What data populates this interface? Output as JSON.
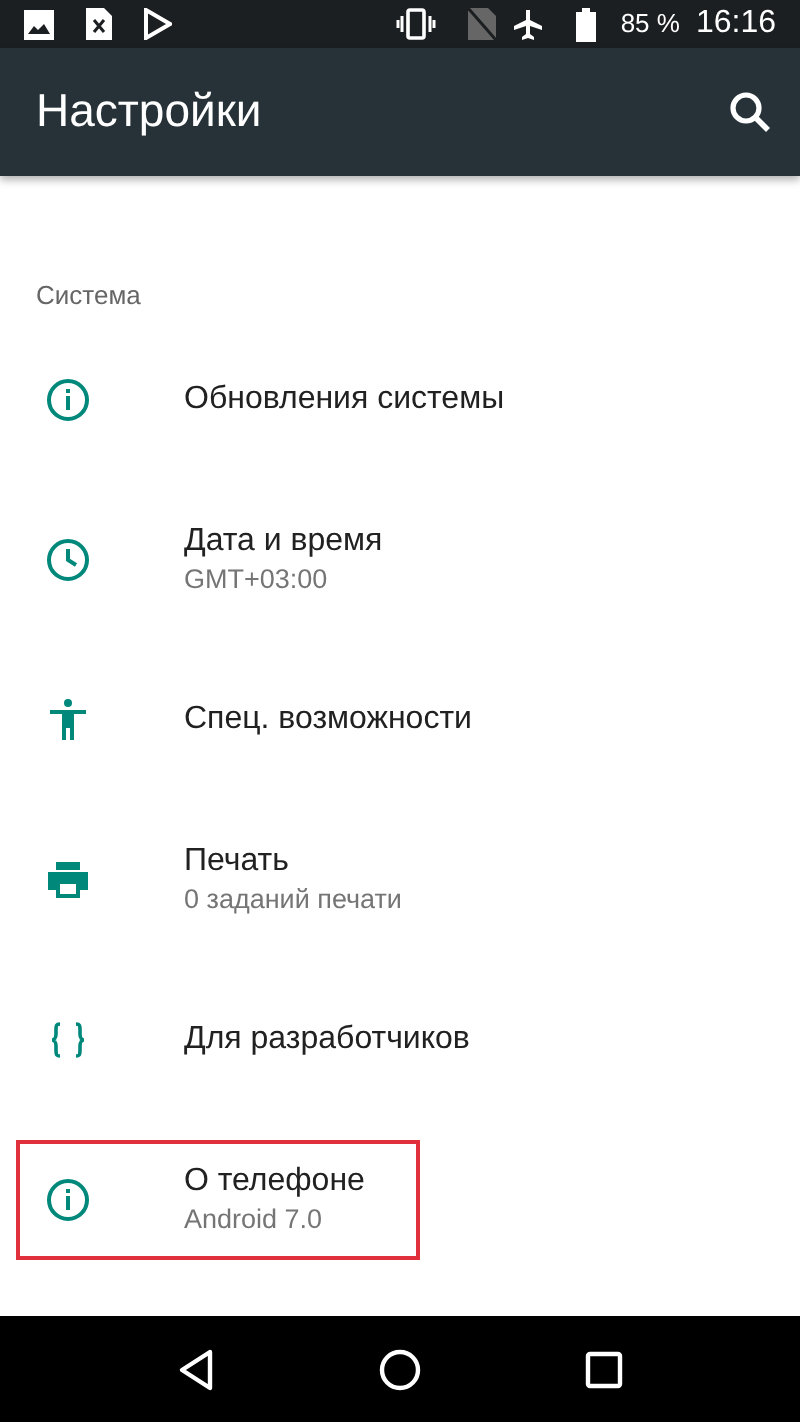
{
  "status_bar": {
    "battery": "85 %",
    "time": "16:16"
  },
  "app_bar": {
    "title": "Настройки"
  },
  "section": {
    "title": "Система"
  },
  "items": [
    {
      "kind": "info",
      "title": "Обновления системы",
      "highlighted": false
    },
    {
      "kind": "clock",
      "title": "Дата и время",
      "subtitle": "GMT+03:00",
      "highlighted": false
    },
    {
      "kind": "accessibility",
      "title": "Спец. возможности",
      "highlighted": false
    },
    {
      "kind": "print",
      "title": "Печать",
      "subtitle": "0 заданий печати",
      "highlighted": false
    },
    {
      "kind": "braces",
      "title": "Для разработчиков",
      "highlighted": false
    },
    {
      "kind": "info",
      "title": "О телефоне",
      "subtitle": "Android 7.0",
      "highlighted": true
    }
  ]
}
